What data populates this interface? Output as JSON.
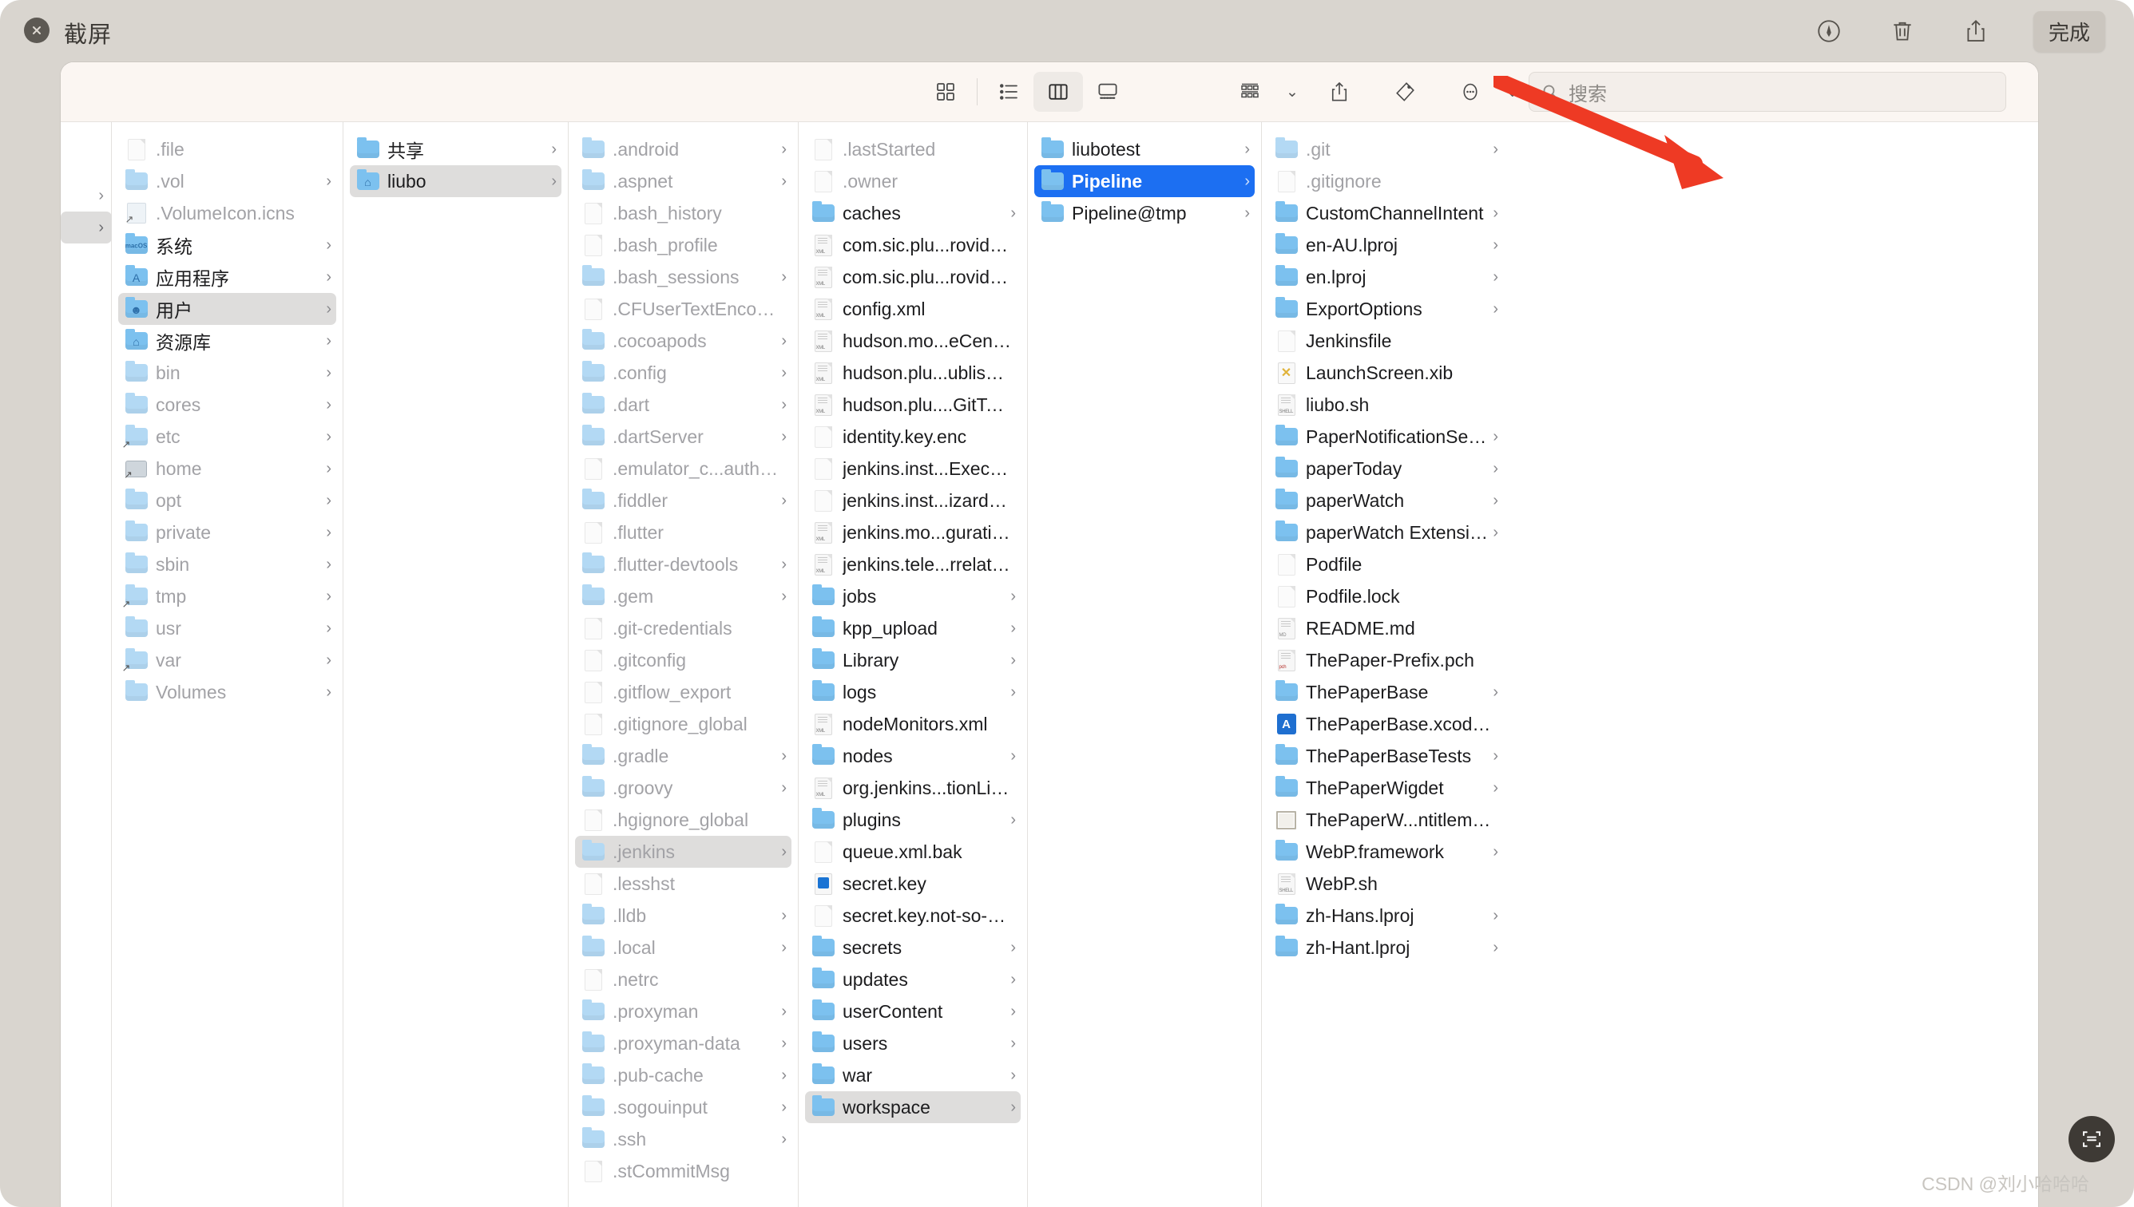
{
  "window": {
    "title": "截屏",
    "close_icon": "close-circle-icon",
    "markup_label": "markup-icon",
    "trash_label": "trash-icon",
    "share_label": "share-icon",
    "done_label": "完成"
  },
  "finder": {
    "toolbar": {
      "views": [
        {
          "name": "icon-view",
          "icon": "grid-icon",
          "active": false
        },
        {
          "name": "list-view",
          "icon": "list-icon",
          "active": false
        },
        {
          "name": "column-view",
          "icon": "columns-icon",
          "active": true
        },
        {
          "name": "gallery-view",
          "icon": "gallery-icon",
          "active": false
        }
      ],
      "actions": [
        {
          "name": "group-by",
          "icon": "group-icon"
        },
        {
          "name": "share",
          "icon": "share-icon"
        },
        {
          "name": "tags",
          "icon": "tag-icon"
        },
        {
          "name": "more",
          "icon": "ellipsis-icon"
        }
      ]
    },
    "search": {
      "placeholder": "搜索",
      "value": "",
      "icon": "search-icon"
    },
    "columns": [
      {
        "id": "root",
        "items": [
          {
            "label": ".file",
            "icon": "document",
            "dim": true,
            "arrow": false
          },
          {
            "label": ".vol",
            "icon": "folder-pale",
            "dim": true,
            "arrow": true
          },
          {
            "label": ".VolumeIcon.icns",
            "icon": "volume-icon-alias",
            "dim": true,
            "arrow": false
          },
          {
            "label": "系统",
            "icon": "folder-macos",
            "dim": false,
            "arrow": true
          },
          {
            "label": "应用程序",
            "icon": "folder-apps",
            "dim": false,
            "arrow": true
          },
          {
            "label": "用户",
            "icon": "folder-users",
            "dim": false,
            "arrow": true,
            "selected": "grey"
          },
          {
            "label": "资源库",
            "icon": "folder-library",
            "dim": false,
            "arrow": true
          },
          {
            "label": "bin",
            "icon": "folder-pale",
            "dim": true,
            "arrow": true
          },
          {
            "label": "cores",
            "icon": "folder-pale",
            "dim": true,
            "arrow": true
          },
          {
            "label": "etc",
            "icon": "folder-alias",
            "dim": true,
            "arrow": true
          },
          {
            "label": "home",
            "icon": "hdd-alias",
            "dim": true,
            "arrow": true
          },
          {
            "label": "opt",
            "icon": "folder-pale",
            "dim": true,
            "arrow": true
          },
          {
            "label": "private",
            "icon": "folder-pale",
            "dim": true,
            "arrow": true
          },
          {
            "label": "sbin",
            "icon": "folder-pale",
            "dim": true,
            "arrow": true
          },
          {
            "label": "tmp",
            "icon": "folder-alias",
            "dim": true,
            "arrow": true
          },
          {
            "label": "usr",
            "icon": "folder-pale",
            "dim": true,
            "arrow": true
          },
          {
            "label": "var",
            "icon": "folder-alias",
            "dim": true,
            "arrow": true
          },
          {
            "label": "Volumes",
            "icon": "folder-pale",
            "dim": true,
            "arrow": true
          }
        ]
      },
      {
        "id": "users",
        "items": [
          {
            "label": "共享",
            "icon": "folder",
            "dim": false,
            "arrow": true
          },
          {
            "label": "liubo",
            "icon": "folder-home",
            "dim": false,
            "arrow": true,
            "selected": "grey"
          }
        ]
      },
      {
        "id": "liubo",
        "items": [
          {
            "label": ".android",
            "icon": "folder-pale",
            "dim": true,
            "arrow": true
          },
          {
            "label": ".aspnet",
            "icon": "folder-pale",
            "dim": true,
            "arrow": true
          },
          {
            "label": ".bash_history",
            "icon": "document",
            "dim": true,
            "arrow": false
          },
          {
            "label": ".bash_profile",
            "icon": "document",
            "dim": true,
            "arrow": false
          },
          {
            "label": ".bash_sessions",
            "icon": "folder-pale",
            "dim": true,
            "arrow": true
          },
          {
            "label": ".CFUserTextEncoding",
            "icon": "document",
            "dim": true,
            "arrow": false
          },
          {
            "label": ".cocoapods",
            "icon": "folder-pale",
            "dim": true,
            "arrow": true
          },
          {
            "label": ".config",
            "icon": "folder-pale",
            "dim": true,
            "arrow": true
          },
          {
            "label": ".dart",
            "icon": "folder-pale",
            "dim": true,
            "arrow": true
          },
          {
            "label": ".dartServer",
            "icon": "folder-pale",
            "dim": true,
            "arrow": true
          },
          {
            "label": ".emulator_c...auth_token",
            "icon": "document",
            "dim": true,
            "arrow": false
          },
          {
            "label": ".fiddler",
            "icon": "folder-pale",
            "dim": true,
            "arrow": true
          },
          {
            "label": ".flutter",
            "icon": "document",
            "dim": true,
            "arrow": false
          },
          {
            "label": ".flutter-devtools",
            "icon": "folder-pale",
            "dim": true,
            "arrow": true
          },
          {
            "label": ".gem",
            "icon": "folder-pale",
            "dim": true,
            "arrow": true
          },
          {
            "label": ".git-credentials",
            "icon": "document",
            "dim": true,
            "arrow": false
          },
          {
            "label": ".gitconfig",
            "icon": "document",
            "dim": true,
            "arrow": false
          },
          {
            "label": ".gitflow_export",
            "icon": "document",
            "dim": true,
            "arrow": false
          },
          {
            "label": ".gitignore_global",
            "icon": "document",
            "dim": true,
            "arrow": false
          },
          {
            "label": ".gradle",
            "icon": "folder-pale",
            "dim": true,
            "arrow": true
          },
          {
            "label": ".groovy",
            "icon": "folder-pale",
            "dim": true,
            "arrow": true
          },
          {
            "label": ".hgignore_global",
            "icon": "document",
            "dim": true,
            "arrow": false
          },
          {
            "label": ".jenkins",
            "icon": "folder-pale",
            "dim": true,
            "arrow": true,
            "selected": "grey"
          },
          {
            "label": ".lesshst",
            "icon": "document",
            "dim": true,
            "arrow": false
          },
          {
            "label": ".lldb",
            "icon": "folder-pale",
            "dim": true,
            "arrow": true
          },
          {
            "label": ".local",
            "icon": "folder-pale",
            "dim": true,
            "arrow": true
          },
          {
            "label": ".netrc",
            "icon": "document",
            "dim": true,
            "arrow": false
          },
          {
            "label": ".proxyman",
            "icon": "folder-pale",
            "dim": true,
            "arrow": true
          },
          {
            "label": ".proxyman-data",
            "icon": "folder-pale",
            "dim": true,
            "arrow": true
          },
          {
            "label": ".pub-cache",
            "icon": "folder-pale",
            "dim": true,
            "arrow": true
          },
          {
            "label": ".sogouinput",
            "icon": "folder-pale",
            "dim": true,
            "arrow": true
          },
          {
            "label": ".ssh",
            "icon": "folder-pale",
            "dim": true,
            "arrow": true
          },
          {
            "label": ".stCommitMsg",
            "icon": "document",
            "dim": true,
            "arrow": false
          }
        ]
      },
      {
        "id": "jenkins",
        "items": [
          {
            "label": ".lastStarted",
            "icon": "document",
            "dim": true,
            "arrow": false
          },
          {
            "label": ".owner",
            "icon": "document",
            "dim": true,
            "arrow": false
          },
          {
            "label": "caches",
            "icon": "folder",
            "dim": false,
            "arrow": true
          },
          {
            "label": "com.sic.plu...rovider.xml",
            "icon": "xml",
            "dim": false,
            "arrow": false
          },
          {
            "label": "com.sic.plu...rovider.xml",
            "icon": "xml",
            "dim": false,
            "arrow": false
          },
          {
            "label": "config.xml",
            "icon": "xml",
            "dim": false,
            "arrow": false
          },
          {
            "label": "hudson.mo...eCenter.xml",
            "icon": "xml",
            "dim": false,
            "arrow": false
          },
          {
            "label": "hudson.plu...ublisher.xml",
            "icon": "xml",
            "dim": false,
            "arrow": false
          },
          {
            "label": "hudson.plu....GitTool.xml",
            "icon": "xml",
            "dim": false,
            "arrow": false
          },
          {
            "label": "identity.key.enc",
            "icon": "document",
            "dim": false,
            "arrow": false
          },
          {
            "label": "jenkins.inst...ExecVersion",
            "icon": "document",
            "dim": false,
            "arrow": false
          },
          {
            "label": "jenkins.inst...izard.state",
            "icon": "document",
            "dim": false,
            "arrow": false
          },
          {
            "label": "jenkins.mo...guration.xml",
            "icon": "xml",
            "dim": false,
            "arrow": false
          },
          {
            "label": "jenkins.tele...rrelator.xml",
            "icon": "xml",
            "dim": false,
            "arrow": false
          },
          {
            "label": "jobs",
            "icon": "folder",
            "dim": false,
            "arrow": true
          },
          {
            "label": "kpp_upload",
            "icon": "folder",
            "dim": false,
            "arrow": true
          },
          {
            "label": "Library",
            "icon": "folder",
            "dim": false,
            "arrow": true
          },
          {
            "label": "logs",
            "icon": "folder",
            "dim": false,
            "arrow": true
          },
          {
            "label": "nodeMonitors.xml",
            "icon": "xml",
            "dim": false,
            "arrow": false
          },
          {
            "label": "nodes",
            "icon": "folder",
            "dim": false,
            "arrow": true
          },
          {
            "label": "org.jenkins...tionList.xml",
            "icon": "xml",
            "dim": false,
            "arrow": false
          },
          {
            "label": "plugins",
            "icon": "folder",
            "dim": false,
            "arrow": true
          },
          {
            "label": "queue.xml.bak",
            "icon": "document",
            "dim": false,
            "arrow": false
          },
          {
            "label": "secret.key",
            "icon": "key",
            "dim": false,
            "arrow": false
          },
          {
            "label": "secret.key.not-so-secret",
            "icon": "document",
            "dim": false,
            "arrow": false
          },
          {
            "label": "secrets",
            "icon": "folder",
            "dim": false,
            "arrow": true
          },
          {
            "label": "updates",
            "icon": "folder",
            "dim": false,
            "arrow": true
          },
          {
            "label": "userContent",
            "icon": "folder",
            "dim": false,
            "arrow": true
          },
          {
            "label": "users",
            "icon": "folder",
            "dim": false,
            "arrow": true
          },
          {
            "label": "war",
            "icon": "folder",
            "dim": false,
            "arrow": true
          },
          {
            "label": "workspace",
            "icon": "folder",
            "dim": false,
            "arrow": true,
            "selected": "grey"
          }
        ]
      },
      {
        "id": "workspace",
        "items": [
          {
            "label": "liubotest",
            "icon": "folder",
            "dim": false,
            "arrow": true
          },
          {
            "label": "Pipeline",
            "icon": "folder",
            "dim": false,
            "arrow": true,
            "selected": "blue"
          },
          {
            "label": "Pipeline@tmp",
            "icon": "folder",
            "dim": false,
            "arrow": true
          }
        ]
      },
      {
        "id": "pipeline",
        "items": [
          {
            "label": ".git",
            "icon": "folder-pale",
            "dim": true,
            "arrow": true
          },
          {
            "label": ".gitignore",
            "icon": "document",
            "dim": true,
            "arrow": false
          },
          {
            "label": "CustomChannelIntent",
            "icon": "folder",
            "dim": false,
            "arrow": true
          },
          {
            "label": "en-AU.lproj",
            "icon": "folder",
            "dim": false,
            "arrow": true
          },
          {
            "label": "en.lproj",
            "icon": "folder",
            "dim": false,
            "arrow": true
          },
          {
            "label": "ExportOptions",
            "icon": "folder",
            "dim": false,
            "arrow": true
          },
          {
            "label": "Jenkinsfile",
            "icon": "document",
            "dim": false,
            "arrow": false
          },
          {
            "label": "LaunchScreen.xib",
            "icon": "xib",
            "dim": false,
            "arrow": false
          },
          {
            "label": "liubo.sh",
            "icon": "shell",
            "dim": false,
            "arrow": false
          },
          {
            "label": "PaperNotificationServer",
            "icon": "folder",
            "dim": false,
            "arrow": true
          },
          {
            "label": "paperToday",
            "icon": "folder",
            "dim": false,
            "arrow": true
          },
          {
            "label": "paperWatch",
            "icon": "folder",
            "dim": false,
            "arrow": true
          },
          {
            "label": "paperWatch Extension",
            "icon": "folder",
            "dim": false,
            "arrow": true
          },
          {
            "label": "Podfile",
            "icon": "document",
            "dim": false,
            "arrow": false
          },
          {
            "label": "Podfile.lock",
            "icon": "document",
            "dim": false,
            "arrow": false
          },
          {
            "label": "README.md",
            "icon": "md",
            "dim": false,
            "arrow": false
          },
          {
            "label": "ThePaper-Prefix.pch",
            "icon": "pch",
            "dim": false,
            "arrow": false
          },
          {
            "label": "ThePaperBase",
            "icon": "folder",
            "dim": false,
            "arrow": true
          },
          {
            "label": "ThePaperBase.xcodeproj",
            "icon": "xcodeproj",
            "dim": false,
            "arrow": false
          },
          {
            "label": "ThePaperBaseTests",
            "icon": "folder",
            "dim": false,
            "arrow": true
          },
          {
            "label": "ThePaperWigdet",
            "icon": "folder",
            "dim": false,
            "arrow": true
          },
          {
            "label": "ThePaperW...ntitlements",
            "icon": "entitlements",
            "dim": false,
            "arrow": false
          },
          {
            "label": "WebP.framework",
            "icon": "folder",
            "dim": false,
            "arrow": true
          },
          {
            "label": "WebP.sh",
            "icon": "shell",
            "dim": false,
            "arrow": false
          },
          {
            "label": "zh-Hans.lproj",
            "icon": "folder",
            "dim": false,
            "arrow": true
          },
          {
            "label": "zh-Hant.lproj",
            "icon": "folder",
            "dim": false,
            "arrow": true
          }
        ]
      }
    ]
  },
  "annotation": {
    "arrow_color": "#ee3a24",
    "arrow_name": "red-arrow-pointing-to-pipeline"
  },
  "watermark": {
    "text": "CSDN @刘小哈哈哈"
  },
  "colors": {
    "selection_blue": "#1c6ff2",
    "selection_grey": "#dedddc",
    "folder_blue": "#7cc1ef",
    "titlebar_bg": "#d9d5cf"
  }
}
